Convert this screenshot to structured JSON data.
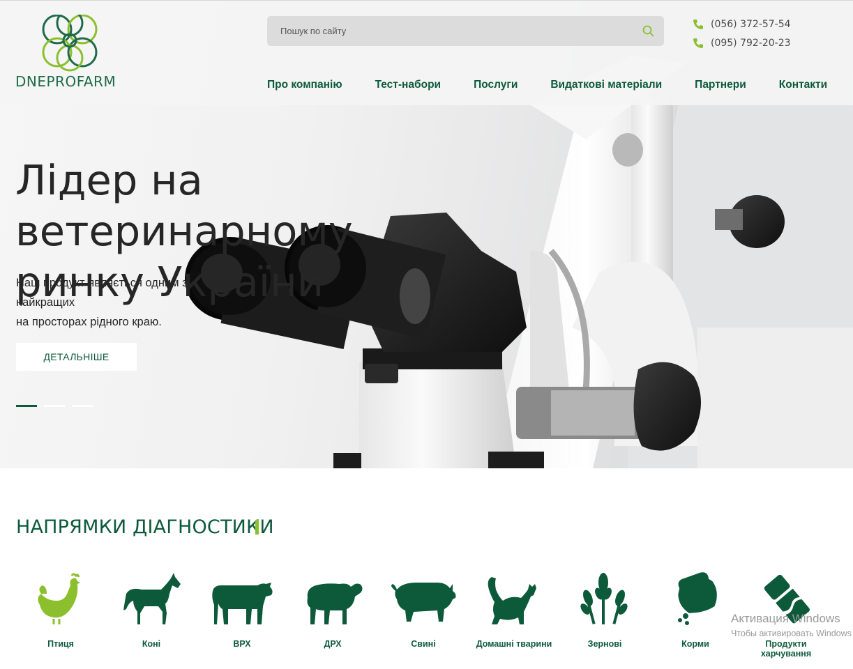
{
  "brand": {
    "name": "DNEPROFARM",
    "primary_color": "#0d5a3b",
    "accent_color": "#8cbf2d"
  },
  "search": {
    "placeholder": "Пошук по сайту",
    "icon": "search-icon"
  },
  "phones": [
    {
      "number": "(056) 372-57-54",
      "icon": "phone-icon"
    },
    {
      "number": "(095) 792-20-23",
      "icon": "phone-icon"
    }
  ],
  "nav": [
    {
      "label": "Про компанію"
    },
    {
      "label": "Тест-набори"
    },
    {
      "label": "Послуги"
    },
    {
      "label": "Видаткові матеріали"
    },
    {
      "label": "Партнери"
    },
    {
      "label": "Контакти"
    }
  ],
  "hero": {
    "title_line1": "Лідер на ветеринарному",
    "title_line2": "ринку України",
    "subtitle_line1": "Наш продукт являється одним з найкращих",
    "subtitle_line2": "на просторах рідного краю.",
    "button_label": "ДЕТАЛЬНІШЕ",
    "slides_total": 3,
    "active_slide": 1
  },
  "section": {
    "title": "НАПРЯМКИ ДІАГНОСТИКИ"
  },
  "categories": [
    {
      "label": "Птиця",
      "icon": "chicken-icon"
    },
    {
      "label": "Коні",
      "icon": "horse-icon"
    },
    {
      "label": "ВРХ",
      "icon": "cow-icon"
    },
    {
      "label": "ДРХ",
      "icon": "sheep-icon"
    },
    {
      "label": "Свині",
      "icon": "pig-icon"
    },
    {
      "label": "Домашні тварини",
      "icon": "cat-icon"
    },
    {
      "label": "Зернові",
      "icon": "wheat-icon"
    },
    {
      "label": "Корми",
      "icon": "feed-bag-icon"
    },
    {
      "label": "Продукти харчування",
      "icon": "food-products-icon"
    }
  ],
  "os_watermark": {
    "line1": "Активация Windows",
    "line2": "Чтобы активировать Windows"
  }
}
